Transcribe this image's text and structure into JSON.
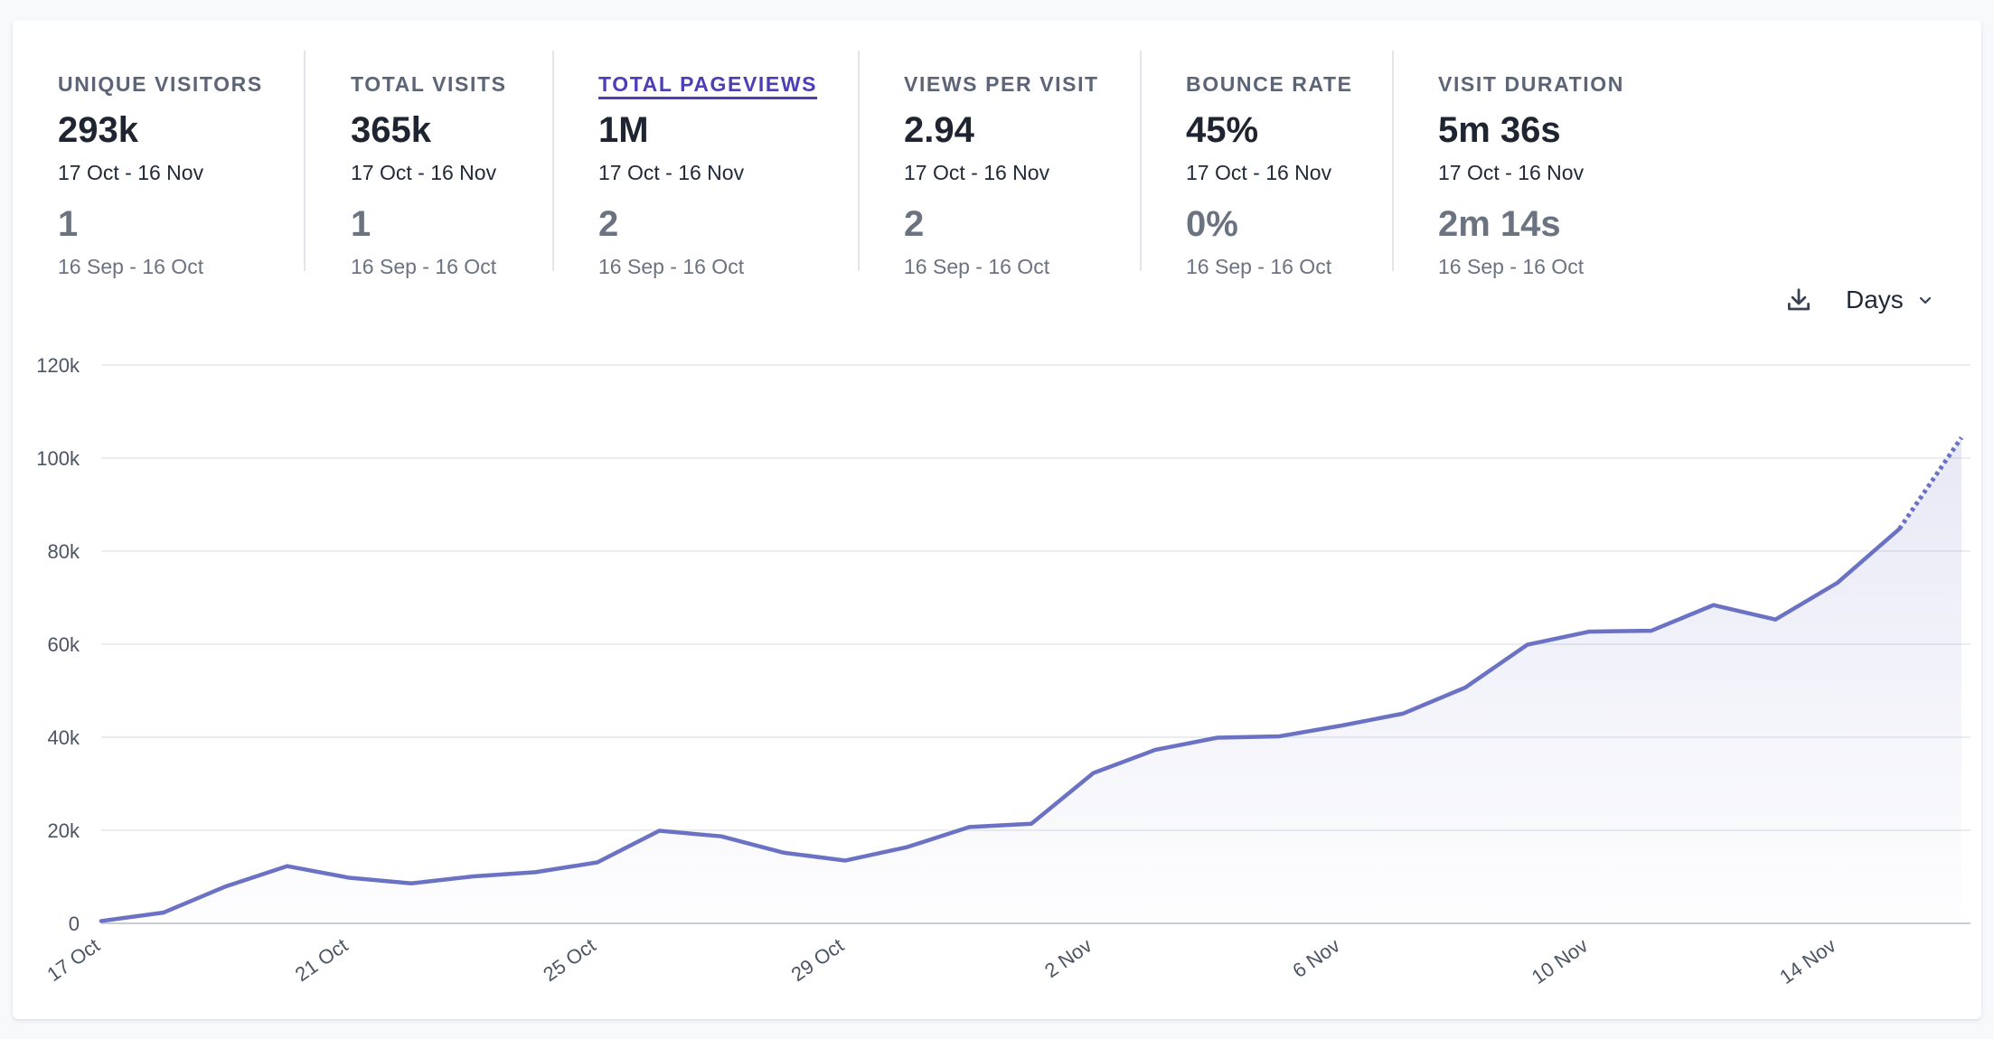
{
  "metrics": [
    {
      "label": "UNIQUE VISITORS",
      "value": "293k",
      "range": "17 Oct - 16 Nov",
      "prev_value": "1",
      "prev_range": "16 Sep - 16 Oct"
    },
    {
      "label": "TOTAL VISITS",
      "value": "365k",
      "range": "17 Oct - 16 Nov",
      "prev_value": "1",
      "prev_range": "16 Sep - 16 Oct"
    },
    {
      "label": "TOTAL PAGEVIEWS",
      "value": "1M",
      "range": "17 Oct - 16 Nov",
      "prev_value": "2",
      "prev_range": "16 Sep - 16 Oct",
      "active": true
    },
    {
      "label": "VIEWS PER VISIT",
      "value": "2.94",
      "range": "17 Oct - 16 Nov",
      "prev_value": "2",
      "prev_range": "16 Sep - 16 Oct"
    },
    {
      "label": "BOUNCE RATE",
      "value": "45%",
      "range": "17 Oct - 16 Nov",
      "prev_value": "0%",
      "prev_range": "16 Sep - 16 Oct"
    },
    {
      "label": "VISIT DURATION",
      "value": "5m 36s",
      "range": "17 Oct - 16 Nov",
      "prev_value": "2m 14s",
      "prev_range": "16 Sep - 16 Oct"
    }
  ],
  "toolbar": {
    "download_icon": "download-icon",
    "interval_label": "Days",
    "interval_icon": "chevron-down-icon"
  },
  "colors": {
    "accent": "#6b72c4",
    "active_metric": "#4b3fb8",
    "grid": "#e5e7eb"
  },
  "chart_data": {
    "type": "area",
    "title": "",
    "xlabel": "",
    "ylabel": "",
    "ylim": [
      0,
      120000
    ],
    "yticks": [
      0,
      20000,
      40000,
      60000,
      80000,
      100000,
      120000
    ],
    "ytick_labels": [
      "0",
      "20k",
      "40k",
      "60k",
      "80k",
      "100k",
      "120k"
    ],
    "xtick_labels": [
      "17 Oct",
      "21 Oct",
      "25 Oct",
      "29 Oct",
      "2 Nov",
      "6 Nov",
      "10 Nov",
      "14 Nov"
    ],
    "grid": true,
    "categories": [
      "17 Oct",
      "18 Oct",
      "19 Oct",
      "20 Oct",
      "21 Oct",
      "22 Oct",
      "23 Oct",
      "24 Oct",
      "25 Oct",
      "26 Oct",
      "27 Oct",
      "28 Oct",
      "29 Oct",
      "30 Oct",
      "31 Oct",
      "1 Nov",
      "2 Nov",
      "3 Nov",
      "4 Nov",
      "5 Nov",
      "6 Nov",
      "7 Nov",
      "8 Nov",
      "9 Nov",
      "10 Nov",
      "11 Nov",
      "12 Nov",
      "13 Nov",
      "14 Nov",
      "15 Nov",
      "16 Nov"
    ],
    "series": [
      {
        "values": [
          500,
          2300,
          7900,
          12300,
          9800,
          8600,
          10100,
          11000,
          13100,
          19900,
          18700,
          15200,
          13500,
          16400,
          20700,
          21400,
          32300,
          37300,
          39900,
          40200,
          42500,
          45100,
          50700,
          59900,
          62700,
          62900,
          68400,
          65300,
          73200,
          84800,
          104400
        ],
        "incomplete_from_index": 29
      }
    ]
  }
}
